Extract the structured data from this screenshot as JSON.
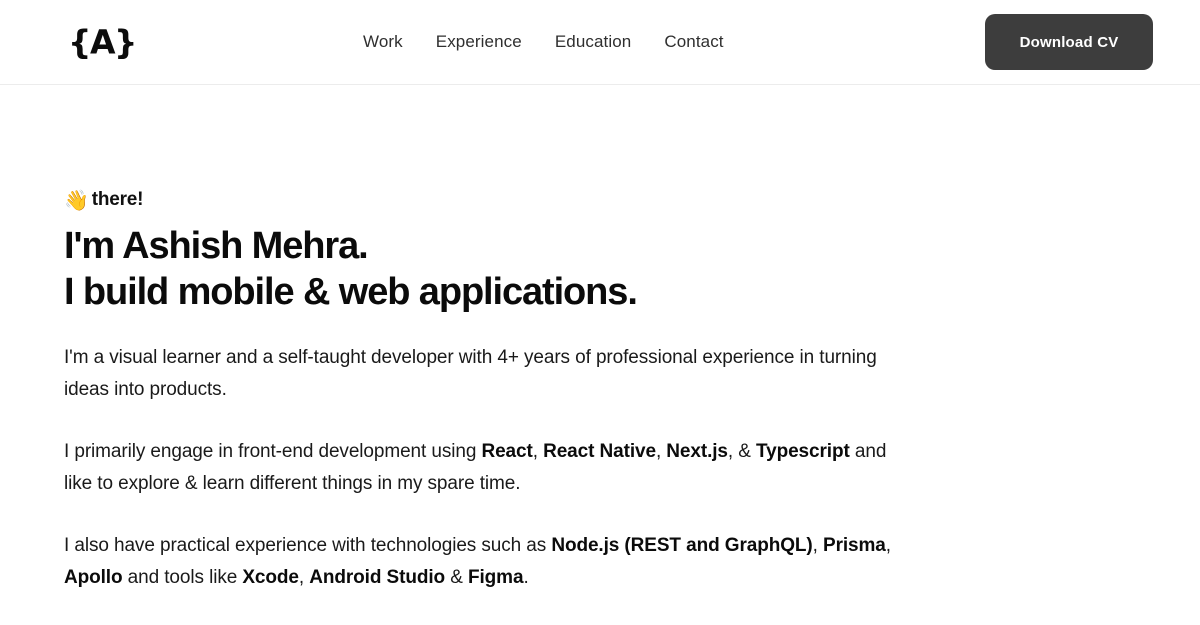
{
  "header": {
    "logo_text": "{A}",
    "nav": [
      {
        "label": "Work"
      },
      {
        "label": "Experience"
      },
      {
        "label": "Education"
      },
      {
        "label": "Contact"
      }
    ],
    "cv_button_label": "Download CV",
    "cv_button_color": "#3d3d3d",
    "border_color": "#ececec"
  },
  "hero": {
    "wave_emoji": "👋",
    "greeting": "there!",
    "headline_line1": "I'm Ashish Mehra.",
    "headline_line2": "I build mobile & web applications.",
    "paragraphs": [
      [
        {
          "text": "I'm a visual learner and a self-taught developer with 4+ years of professional experience in turning ideas into products.",
          "bold": false
        }
      ],
      [
        {
          "text": "I primarily engage in front-end development using ",
          "bold": false
        },
        {
          "text": "React",
          "bold": true
        },
        {
          "text": ", ",
          "bold": false
        },
        {
          "text": "React Native",
          "bold": true
        },
        {
          "text": ", ",
          "bold": false
        },
        {
          "text": "Next.js",
          "bold": true
        },
        {
          "text": ", & ",
          "bold": false
        },
        {
          "text": "Typescript",
          "bold": true
        },
        {
          "text": " and like to explore & learn different things in my spare time.",
          "bold": false
        }
      ],
      [
        {
          "text": "I also have practical experience with technologies such as ",
          "bold": false
        },
        {
          "text": "Node.js (REST and GraphQL)",
          "bold": true
        },
        {
          "text": ", ",
          "bold": false
        },
        {
          "text": "Prisma",
          "bold": true
        },
        {
          "text": ", ",
          "bold": false
        },
        {
          "text": "Apollo",
          "bold": true
        },
        {
          "text": " and tools like ",
          "bold": false
        },
        {
          "text": "Xcode",
          "bold": true
        },
        {
          "text": ", ",
          "bold": false
        },
        {
          "text": "Android Studio",
          "bold": true
        },
        {
          "text": " & ",
          "bold": false
        },
        {
          "text": "Figma",
          "bold": true
        },
        {
          "text": ".",
          "bold": false
        }
      ]
    ],
    "text_color": "#1a1a1a"
  }
}
